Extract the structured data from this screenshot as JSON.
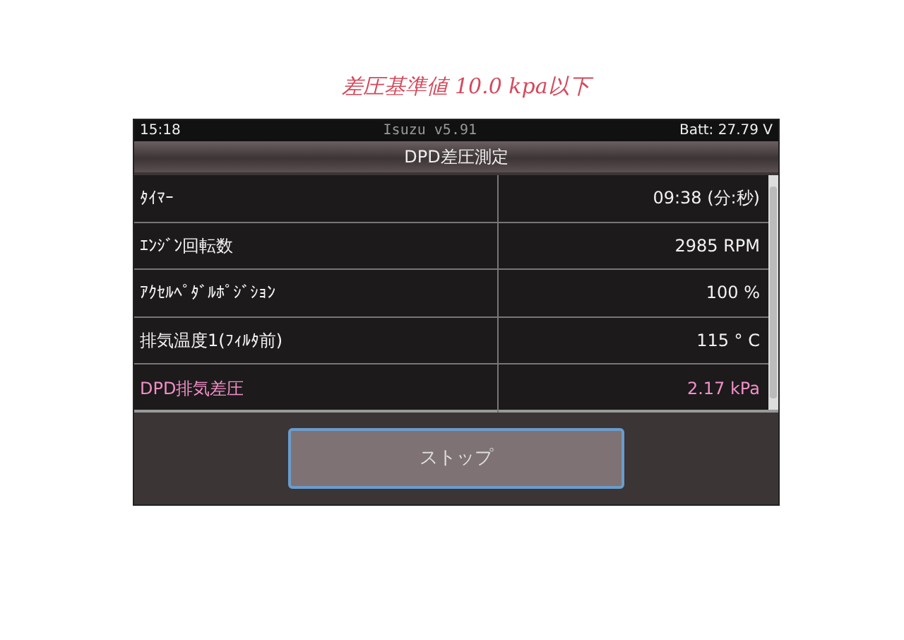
{
  "note": "差圧基準値 10.0 kpa以下",
  "status_bar": {
    "time": "15:18",
    "app": "Isuzu v5.91",
    "battery": "Batt: 27.79 V"
  },
  "title": "DPD差圧測定",
  "rows": [
    {
      "label": "ﾀｲﾏｰ",
      "value": "09:38 (分:秒)",
      "highlighted": false
    },
    {
      "label": "ｴﾝｼﾞﾝ回転数",
      "value": "2985 RPM",
      "highlighted": false
    },
    {
      "label": "ｱｸｾﾙﾍﾟﾀﾞﾙﾎﾟｼﾞｼｮﾝ",
      "value": "100 %",
      "highlighted": false
    },
    {
      "label": "排気温度1(ﾌｨﾙﾀ前)",
      "value": "115 ° C",
      "highlighted": false
    },
    {
      "label": "DPD排気差圧",
      "value": "2.17 kPa",
      "highlighted": true
    }
  ],
  "button": "ストップ"
}
